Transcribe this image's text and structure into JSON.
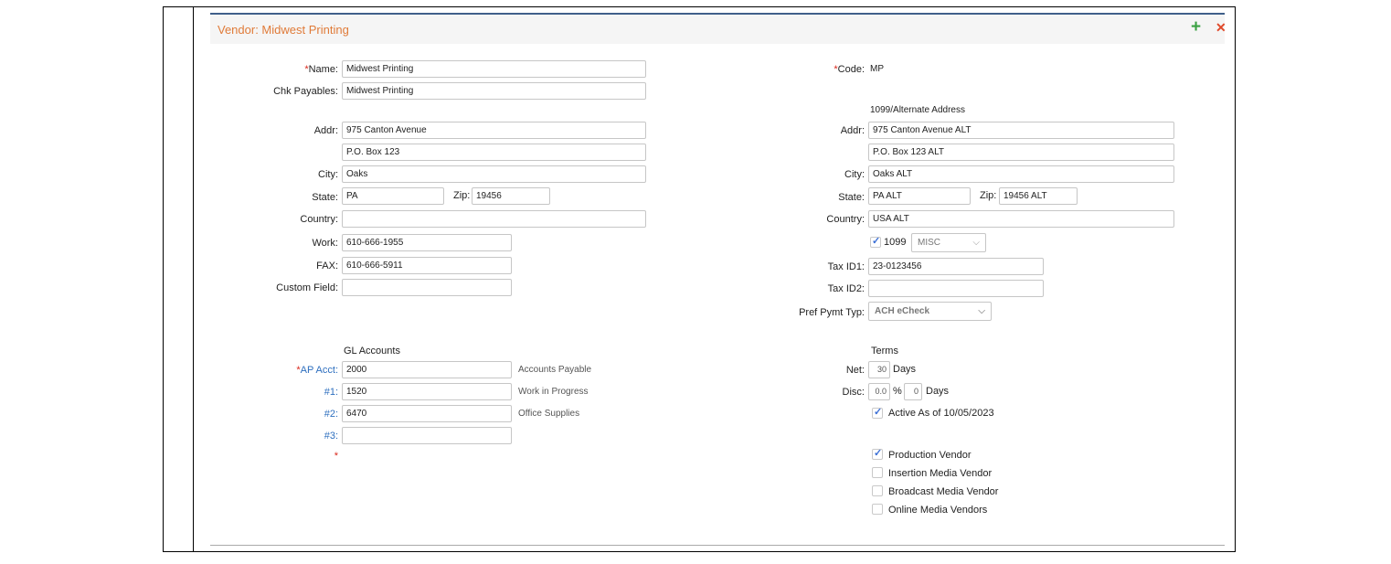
{
  "vendor_title": "Vendor: Midwest Printing",
  "icons": {
    "add": "plus-icon",
    "close": "close-icon"
  },
  "left": {
    "name_label": "Name:",
    "name_value": "Midwest Printing",
    "chk_label": "Chk Payables:",
    "chk_value": "Midwest Printing",
    "addr_label": "Addr:",
    "addr1": "975 Canton Avenue",
    "addr2": "P.O. Box 123",
    "city_label": "City:",
    "city": "Oaks",
    "state_label": "State:",
    "state": "PA",
    "zip_label": "Zip:",
    "zip": "19456",
    "country_label": "Country:",
    "country": "",
    "work_label": "Work:",
    "work": "610-666-1955",
    "fax_label": "FAX:",
    "fax": "610-666-5911",
    "custom_label": "Custom Field:",
    "custom": ""
  },
  "right": {
    "code_label": "Code:",
    "code": "MP",
    "alt_heading": "1099/Alternate Address",
    "addr_label": "Addr:",
    "addr1": "975 Canton Avenue ALT",
    "addr2": "P.O. Box 123 ALT",
    "city_label": "City:",
    "city": "Oaks ALT",
    "state_label": "State:",
    "state": "PA ALT",
    "zip_label": "Zip:",
    "zip": "19456 ALT",
    "country_label": "Country:",
    "country": "USA ALT",
    "form1099_label": "1099",
    "form1099_checked": true,
    "form1099_type": "MISC",
    "taxid1_label": "Tax ID1:",
    "taxid1": "23-0123456",
    "taxid2_label": "Tax ID2:",
    "taxid2": "",
    "pref_label": "Pref Pymt Typ:",
    "pref_value": "ACH eCheck"
  },
  "gl": {
    "heading": "GL Accounts",
    "ap_label": "AP Acct:",
    "ap_value": "2000",
    "ap_desc": "Accounts Payable",
    "n1_label": "#1:",
    "n1_value": "1520",
    "n1_desc": "Work in Progress",
    "n2_label": "#2:",
    "n2_value": "6470",
    "n2_desc": "Office Supplies",
    "n3_label": "#3:",
    "n3_value": "",
    "n3_desc": "",
    "required_mark": "*"
  },
  "terms": {
    "heading": "Terms",
    "net_label": "Net:",
    "net_value": "30",
    "net_unit": "Days",
    "disc_label": "Disc:",
    "disc_pct": "0.0",
    "pct_sign": "%",
    "disc_days": "0",
    "disc_unit": "Days",
    "active_label": "Active As of 10/05/2023",
    "active_checked": true
  },
  "vendor_types": [
    {
      "label": "Production Vendor",
      "checked": true
    },
    {
      "label": "Insertion Media Vendor",
      "checked": false
    },
    {
      "label": "Broadcast Media Vendor",
      "checked": false
    },
    {
      "label": "Online Media Vendors",
      "checked": false
    }
  ],
  "colors": {
    "accent_title": "#e07b39",
    "required": "#d9281c",
    "link": "#2e6fbf",
    "add": "#3aa142",
    "close": "#e04a2b"
  }
}
